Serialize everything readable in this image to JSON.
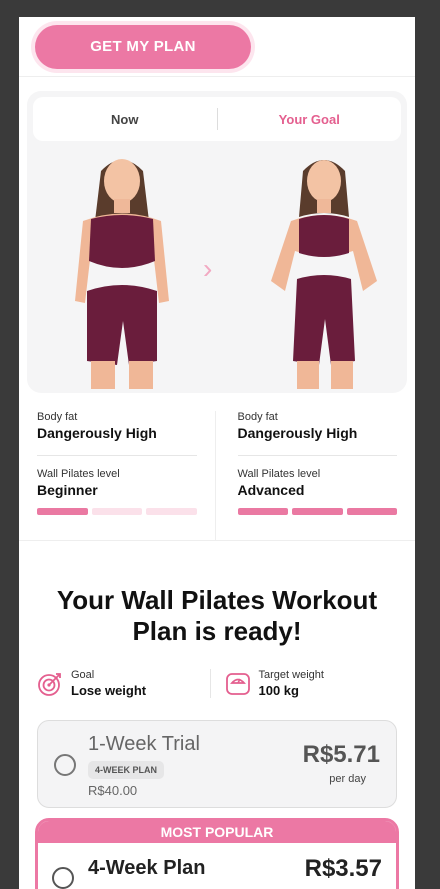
{
  "header": {
    "cta_label": "GET MY PLAN"
  },
  "comparison": {
    "tabs": {
      "now": "Now",
      "goal": "Your Goal"
    },
    "now": {
      "body_fat_label": "Body fat",
      "body_fat_value": "Dangerously High",
      "level_label": "Wall Pilates level",
      "level_value": "Beginner",
      "level_filled": 1,
      "level_total": 3
    },
    "goal": {
      "body_fat_label": "Body fat",
      "body_fat_value": "Dangerously High",
      "level_label": "Wall Pilates level",
      "level_value": "Advanced",
      "level_filled": 3,
      "level_total": 3
    }
  },
  "plan_ready": {
    "title_line1": "Your Wall Pilates Workout",
    "title_line2": "Plan is ready!",
    "goal_label": "Goal",
    "goal_value": "Lose weight",
    "target_label": "Target weight",
    "target_value": "100 kg"
  },
  "plans": [
    {
      "name": "1-Week Trial",
      "badge": "4-WEEK PLAN",
      "total": "R$40.00",
      "price": "R$5.71",
      "per": "per day"
    },
    {
      "header": "MOST POPULAR",
      "name": "4-Week Plan",
      "price": "R$3.57"
    }
  ],
  "colors": {
    "accent": "#ec78a4",
    "accent_light": "#fbe1ea",
    "goal_text": "#e45f8f"
  },
  "icons": {
    "goal": "target-icon",
    "target": "scale-icon",
    "arrow": "chevron-right-icon"
  }
}
